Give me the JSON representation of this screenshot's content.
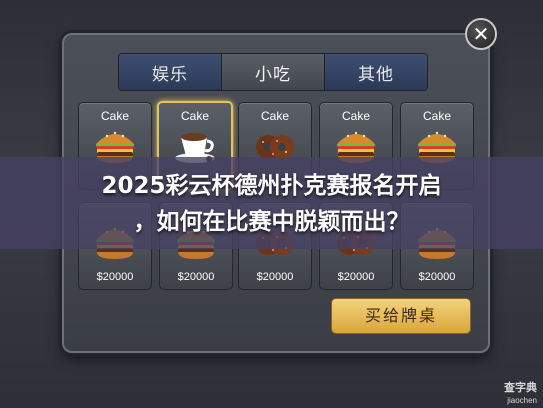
{
  "tabs": [
    {
      "label": "娱乐",
      "active": false
    },
    {
      "label": "小吃",
      "active": true
    },
    {
      "label": "其他",
      "active": false
    }
  ],
  "close": {
    "label": "✕"
  },
  "items_top": [
    {
      "name": "Cake",
      "icon": "burger-icon"
    },
    {
      "name": "Cake",
      "icon": "coffee-icon",
      "selected": true
    },
    {
      "name": "Cake",
      "icon": "donut-icon"
    },
    {
      "name": "Cake",
      "icon": "burger-icon"
    },
    {
      "name": "Cake",
      "icon": "burger-icon"
    }
  ],
  "items_bottom": [
    {
      "price": "$20000",
      "icon": "burger-icon"
    },
    {
      "price": "$20000",
      "icon": "burger-icon"
    },
    {
      "price": "$20000",
      "icon": "donut-icon"
    },
    {
      "price": "$20000",
      "icon": "donut-icon"
    },
    {
      "price": "$20000",
      "icon": "burger-icon"
    }
  ],
  "buy_button": "买给牌桌",
  "headline": {
    "line1": "2025彩云杯德州扑克赛报名开启",
    "line2": "，如何在比赛中脱颖而出？"
  },
  "watermark": {
    "line1": "查字典",
    "line2": "jiaochen"
  },
  "colors": {
    "accent": "#e7c45b",
    "tab": "#3e4f73",
    "button": "#f4d37d"
  }
}
